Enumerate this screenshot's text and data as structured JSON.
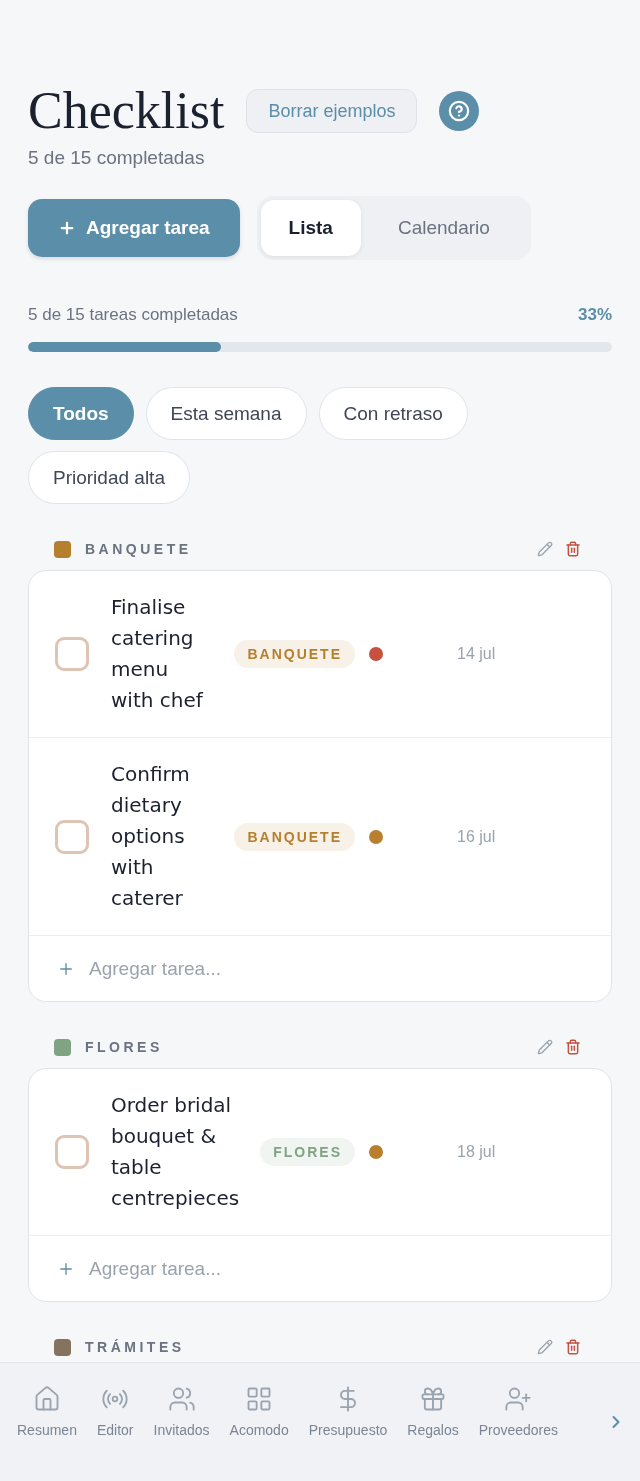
{
  "header": {
    "title": "Checklist",
    "clear_button": "Borrar ejemplos",
    "subtitle": "5 de 15 completadas"
  },
  "toolbar": {
    "add_button": "Agregar tarea",
    "view_tabs": [
      {
        "label": "Lista",
        "selected": true
      },
      {
        "label": "Calendario",
        "selected": false
      }
    ]
  },
  "progress": {
    "label": "5 de 15 tareas completadas",
    "percent": "33%",
    "level": 0.33
  },
  "filters": [
    {
      "label": "Todos",
      "selected": true
    },
    {
      "label": "Esta semana",
      "selected": false
    },
    {
      "label": "Con retraso",
      "selected": false
    },
    {
      "label": "Prioridad alta",
      "selected": false
    }
  ],
  "sections": [
    {
      "title": "BANQUETE",
      "color": "#b57f2e",
      "tasks": [
        {
          "title": "Finalise catering menu with chef",
          "checked": false,
          "tag": "BANQUETE",
          "color": "#c6513f",
          "date": "14 jul"
        },
        {
          "title": "Confirm dietary options with caterer",
          "checked": false,
          "tag": "BANQUETE",
          "color": "#b97f2e",
          "date": "16 jul"
        }
      ],
      "add_placeholder": "Agregar tarea..."
    },
    {
      "title": "FLORES",
      "color": "#7fa383",
      "tasks": [
        {
          "title": "Order bridal bouquet & table centrepieces",
          "checked": false,
          "tag": "FLORES",
          "color": "#b97f2e",
          "date": "18 jul"
        }
      ],
      "add_placeholder": "Agregar tarea..."
    },
    {
      "title": "TRÁMITES",
      "color": "#85735f"
    }
  ],
  "bottom_nav": [
    {
      "label": "Resumen",
      "selected": false
    },
    {
      "label": "Editor",
      "selected": false
    },
    {
      "label": "Invitados",
      "selected": false
    },
    {
      "label": "Acomodo",
      "selected": false
    },
    {
      "label": "Presupuesto",
      "selected": false
    },
    {
      "label": "Regalos",
      "selected": false
    },
    {
      "label": "Proveedores",
      "selected": false
    }
  ]
}
